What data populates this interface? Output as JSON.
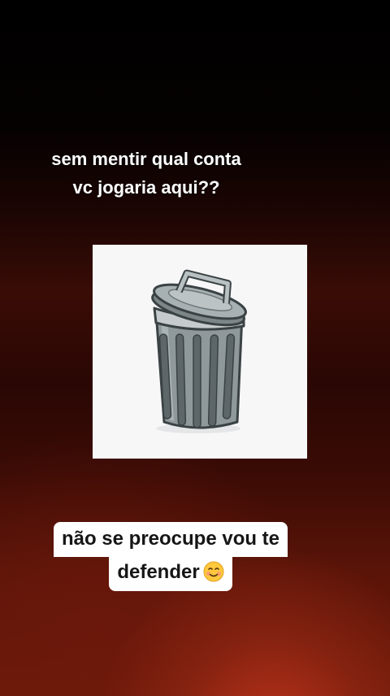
{
  "post": {
    "caption_line1": "sem mentir qual conta",
    "caption_line2": "vc jogaria aqui??",
    "image_subject": "trash-can-icon"
  },
  "reply": {
    "line1": "não se preocupe vou te",
    "line2": "defender",
    "emoji": "smiling-face-icon"
  },
  "colors": {
    "background_top": "#000000",
    "background_bottom": "#6e1a0a",
    "glow": "#b8321a",
    "text_caption": "#ffffff",
    "bubble_bg": "#ffffff",
    "bubble_text": "#161616",
    "can_metal": "#8f999c",
    "can_outline": "#3a4244"
  }
}
